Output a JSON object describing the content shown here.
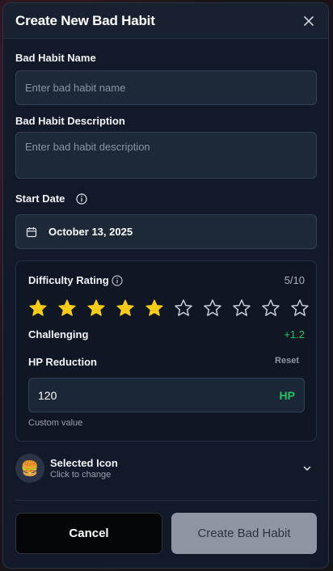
{
  "dialog": {
    "title": "Create New Bad Habit",
    "close_label": "×"
  },
  "name_field": {
    "label": "Bad Habit Name",
    "placeholder": "Enter bad habit name",
    "value": ""
  },
  "description_field": {
    "label": "Bad Habit Description",
    "placeholder": "Enter bad habit description",
    "value": ""
  },
  "start_date": {
    "label": "Start Date",
    "value": "October 13, 2025"
  },
  "difficulty": {
    "label": "Difficulty Rating",
    "score_text": "5/10",
    "rating": 5,
    "max": 10,
    "level_label": "Challenging",
    "modifier": "+1.2",
    "star_filled_color": "#facc15",
    "star_empty_color": "#c9ced6"
  },
  "hp_reduction": {
    "label": "HP Reduction",
    "reset_label": "Reset",
    "value": "120",
    "unit": "HP",
    "hint": "Custom value",
    "accent_color": "#22c55e"
  },
  "icon_picker": {
    "icon": "🍔",
    "icon_name": "burger-icon",
    "title": "Selected Icon",
    "subtitle": "Click to change"
  },
  "actions": {
    "cancel_label": "Cancel",
    "create_label": "Create Bad Habit"
  }
}
